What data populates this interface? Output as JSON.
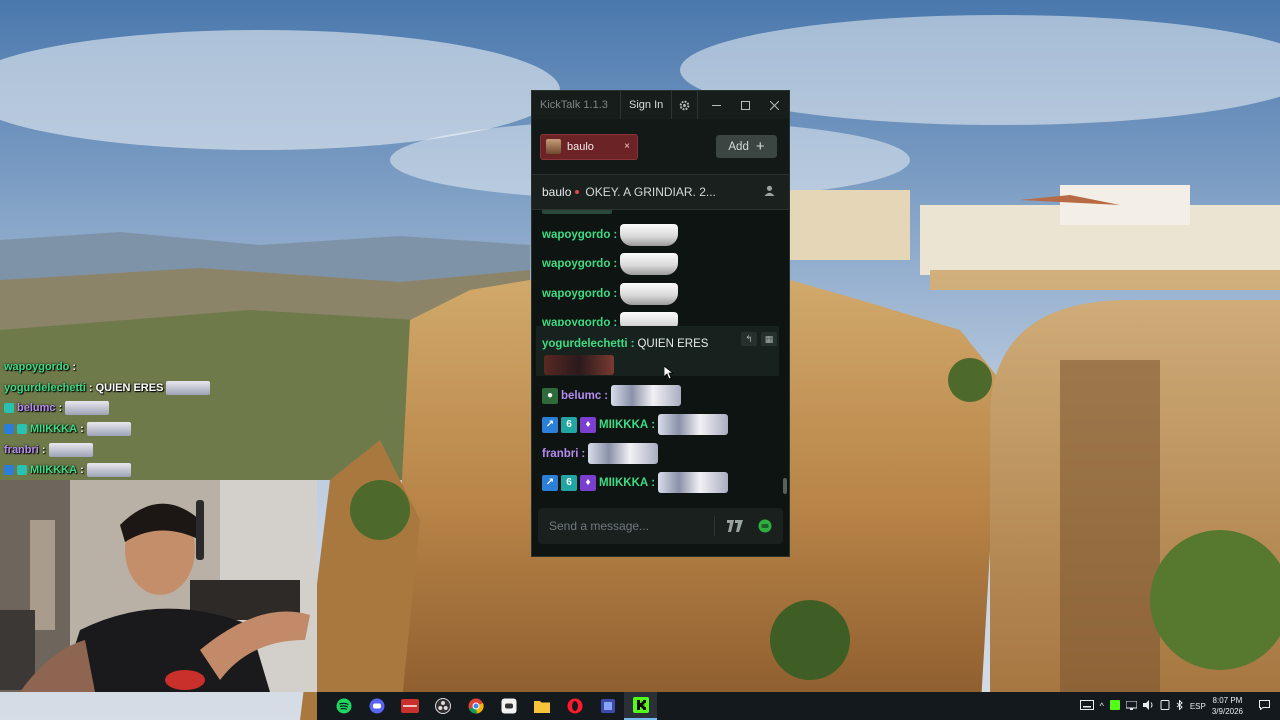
{
  "overlay_chat": [
    {
      "user": "wapoygordo",
      "text": "",
      "color": "#3ddc84",
      "emote": false,
      "badges": 0
    },
    {
      "user": "yogurdelechetti",
      "text": "QUIEN ERES",
      "color": "#3ddc84",
      "emote": true,
      "badges": 0
    },
    {
      "user": "belumc",
      "text": "",
      "color": "#b58cf0",
      "emote": true,
      "badges": 1
    },
    {
      "user": "MIIKKKA",
      "text": "",
      "color": "#3ddc84",
      "emote": true,
      "badges": 3
    },
    {
      "user": "franbri",
      "text": "",
      "color": "#b58cf0",
      "emote": true,
      "badges": 0
    },
    {
      "user": "MIIKKKA",
      "text": "",
      "color": "#3ddc84",
      "emote": true,
      "badges": 3
    }
  ],
  "kicktalk": {
    "app_title": "KickTalk 1.1.3",
    "sign_in": "Sign In",
    "tab": {
      "name": "baulo",
      "close": "×"
    },
    "add_label": "Add",
    "add_icon": "+",
    "stream": {
      "streamer": "baulo",
      "title": "OKEY. A GRINDIAR. 2..."
    },
    "input_placeholder": "Send a message..."
  },
  "messages": [
    {
      "user": "wapoygordo",
      "text": "",
      "color": "#3ddc84",
      "emote": "cup"
    },
    {
      "user": "wapoygordo",
      "text": "",
      "color": "#3ddc84",
      "emote": "cup"
    },
    {
      "user": "wapoygordo",
      "text": "",
      "color": "#3ddc84",
      "emote": "cup"
    },
    {
      "user": "wapoygordo",
      "text": "",
      "color": "#3ddc84",
      "emote": "cup"
    },
    {
      "user": "yogurdelechetti",
      "text": "QUIEN ERES",
      "color": "#3ddc84",
      "emote": "photo"
    },
    {
      "user": "belumc",
      "text": "",
      "color": "#b58cf0",
      "emote": "face",
      "badges": [
        "sub-badge"
      ]
    },
    {
      "user": "MIIKKKA",
      "text": "",
      "color": "#3ddc84",
      "emote": "face",
      "badges": [
        "verified-badge",
        "sub-badge",
        "gift-badge"
      ]
    },
    {
      "user": "franbri",
      "text": "",
      "color": "#b58cf0",
      "emote": "face",
      "badges": []
    },
    {
      "user": "MIIKKKA",
      "text": "",
      "color": "#3ddc84",
      "emote": "face",
      "badges": [
        "verified-badge",
        "sub-badge",
        "gift-badge"
      ]
    }
  ],
  "taskbar": {
    "apps": [
      "spotify-icon",
      "discord-icon",
      "peace-walker-icon",
      "obs-icon",
      "chrome-icon",
      "discord-alt-icon",
      "file-explorer-icon",
      "opera-icon",
      "app-icon",
      "kick-icon"
    ],
    "language": "ESP",
    "time": "8:07 PM",
    "date": "3/9/2026"
  },
  "colors": {
    "kick_green": "#53fc18",
    "tab_red": "#6c2326"
  }
}
